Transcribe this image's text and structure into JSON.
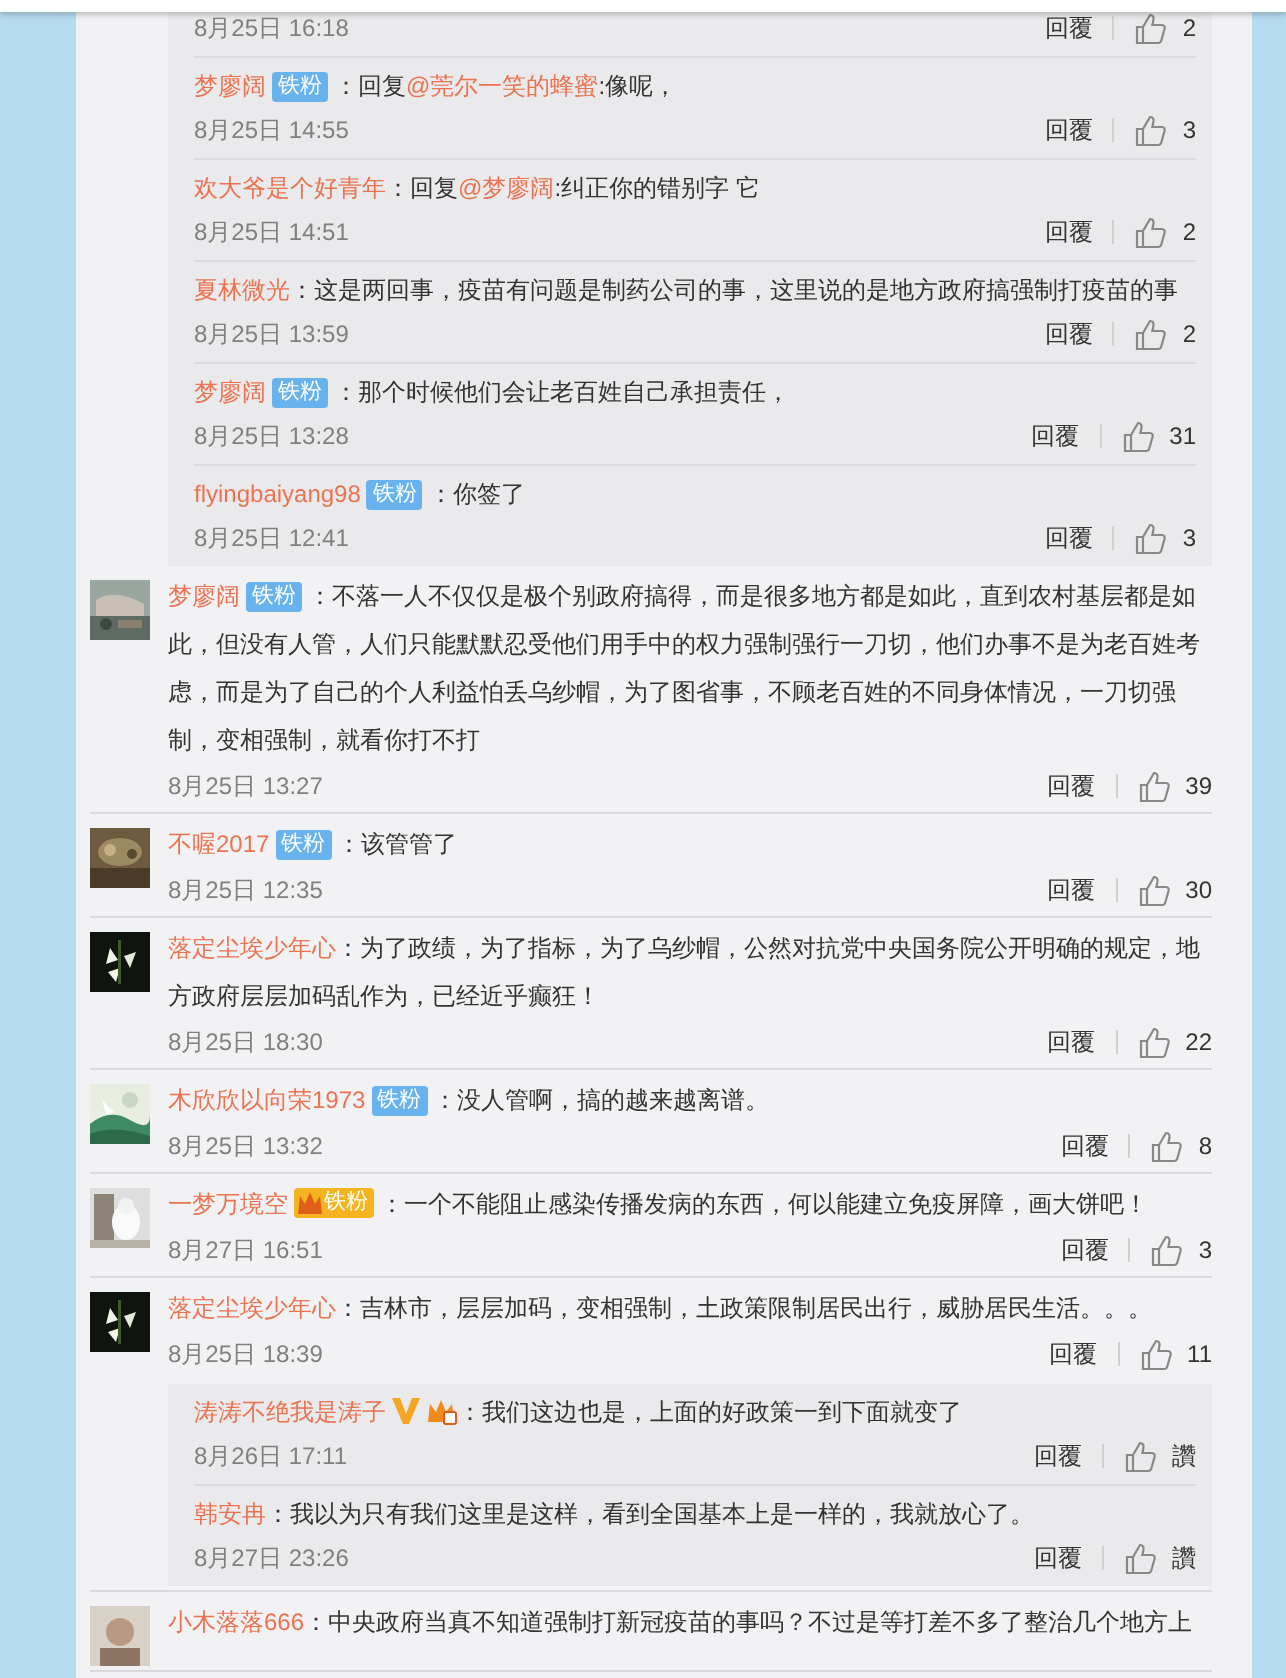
{
  "items": [
    {
      "kind": "reply_group",
      "replies": [
        {
          "date": "8月25日 16:18",
          "reply_label": "回覆",
          "likes": "2"
        },
        {
          "user": "梦廖阔",
          "badges": [
            {
              "kind": "fan",
              "label": "铁粉"
            }
          ],
          "text": [
            {
              "kind": "plain",
              "t": "：回复"
            },
            {
              "kind": "mention",
              "t": "@莞尔一笑的蜂蜜"
            },
            {
              "kind": "plain",
              "t": ":像呢，"
            }
          ],
          "date": "8月25日 14:55",
          "reply_label": "回覆",
          "likes": "3"
        },
        {
          "user": "欢大爷是个好青年",
          "text": [
            {
              "kind": "plain",
              "t": "：回复"
            },
            {
              "kind": "mention",
              "t": "@梦廖阔"
            },
            {
              "kind": "plain",
              "t": ":纠正你的错别字 它"
            }
          ],
          "date": "8月25日 14:51",
          "reply_label": "回覆",
          "likes": "2"
        },
        {
          "user": "夏林微光",
          "text": [
            {
              "kind": "plain",
              "t": "：这是两回事，疫苗有问题是制药公司的事，这里说的是地方政府搞强制打疫苗的事"
            }
          ],
          "date": "8月25日 13:59",
          "reply_label": "回覆",
          "likes": "2"
        },
        {
          "user": "梦廖阔",
          "badges": [
            {
              "kind": "fan",
              "label": "铁粉"
            }
          ],
          "text": [
            {
              "kind": "plain",
              "t": "：那个时候他们会让老百姓自己承担责任，"
            }
          ],
          "date": "8月25日 13:28",
          "reply_label": "回覆",
          "likes": "31"
        },
        {
          "user": "flyingbaiyang98",
          "badges": [
            {
              "kind": "fan",
              "label": "铁粉"
            }
          ],
          "text": [
            {
              "kind": "plain",
              "t": "：你签了"
            }
          ],
          "date": "8月25日 12:41",
          "reply_label": "回覆",
          "likes": "3"
        }
      ]
    },
    {
      "kind": "comment",
      "avatar": {
        "kind": "picture"
      },
      "user": "梦廖阔",
      "badges": [
        {
          "kind": "fan",
          "label": "铁粉"
        }
      ],
      "text": [
        {
          "kind": "plain",
          "t": "：不落一人不仅仅是极个别政府搞得，而是很多地方都是如此，直到农村基层都是如此，但没有人管，人们只能默默忍受他们用手中的权力强制强行一刀切，他们办事不是为老百姓考虑，而是为了自己的个人利益怕丢乌纱帽，为了图省事，不顾老百姓的不同身体情况，一刀切强制，变相强制，就看你打不打"
        }
      ],
      "date": "8月25日 13:27",
      "reply_label": "回覆",
      "likes": "39"
    },
    {
      "kind": "comment",
      "avatar": {
        "kind": "picture"
      },
      "user": "不喔2017",
      "badges": [
        {
          "kind": "fan",
          "label": "铁粉"
        }
      ],
      "text": [
        {
          "kind": "plain",
          "t": "：该管管了"
        }
      ],
      "date": "8月25日 12:35",
      "reply_label": "回覆",
      "likes": "30"
    },
    {
      "kind": "comment",
      "avatar": {
        "kind": "picture"
      },
      "user": "落定尘埃少年心",
      "text": [
        {
          "kind": "plain",
          "t": "：为了政绩，为了指标，为了乌纱帽，公然对抗党中央国务院公开明确的规定，地方政府层层加码乱作为，已经近乎癫狂！"
        }
      ],
      "date": "8月25日 18:30",
      "reply_label": "回覆",
      "likes": "22"
    },
    {
      "kind": "comment",
      "avatar": {
        "kind": "picture"
      },
      "user": "木欣欣以向荣1973",
      "badges": [
        {
          "kind": "fan",
          "label": "铁粉"
        }
      ],
      "text": [
        {
          "kind": "plain",
          "t": "：没人管啊，搞的越来越离谱。"
        }
      ],
      "date": "8月25日 13:32",
      "reply_label": "回覆",
      "likes": "8"
    },
    {
      "kind": "comment",
      "avatar": {
        "kind": "picture"
      },
      "user": "一梦万境空",
      "badges": [
        {
          "kind": "gold_fan",
          "label": "铁粉"
        }
      ],
      "text": [
        {
          "kind": "plain",
          "t": "：一个不能阻止感染传播发病的东西，何以能建立免疫屏障，画大饼吧！"
        }
      ],
      "date": "8月27日 16:51",
      "reply_label": "回覆",
      "likes": "3"
    },
    {
      "kind": "comment",
      "avatar": {
        "kind": "picture"
      },
      "user": "落定尘埃少年心",
      "text": [
        {
          "kind": "plain",
          "t": "：吉林市，层层加码，变相强制，土政策限制居民出行，威胁居民生活。。。"
        }
      ],
      "date": "8月25日 18:39",
      "reply_label": "回覆",
      "likes": "11",
      "replies": [
        {
          "user": "涛涛不绝我是涛子",
          "badges": [
            {
              "kind": "verified"
            },
            {
              "kind": "crown"
            }
          ],
          "text": [
            {
              "kind": "plain",
              "t": "：我们这边也是，上面的好政策一到下面就变了"
            }
          ],
          "date": "8月26日 17:11",
          "reply_label": "回覆",
          "likes": "讚"
        },
        {
          "user": "韩安冉",
          "text": [
            {
              "kind": "plain",
              "t": "：我以为只有我们这里是这样，看到全国基本上是一样的，我就放心了。"
            }
          ],
          "date": "8月27日 23:26",
          "reply_label": "回覆",
          "likes": "讚"
        }
      ]
    },
    {
      "kind": "comment",
      "avatar": {
        "kind": "picture"
      },
      "user": "小木落落666",
      "text": [
        {
          "kind": "plain",
          "t": "：中央政府当真不知道强制打新冠疫苗的事吗？不过是等打差不多了整治几个地方上"
        }
      ]
    }
  ]
}
